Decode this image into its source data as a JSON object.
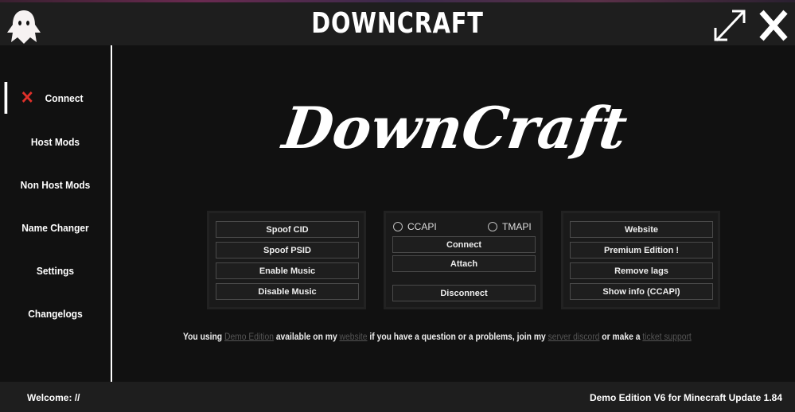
{
  "window": {
    "title": "DOWNCRAFT"
  },
  "logo": {
    "text": "DownCraft"
  },
  "sidebar": {
    "items": [
      {
        "label": "Connect",
        "active": true
      },
      {
        "label": "Host Mods"
      },
      {
        "label": "Non Host Mods"
      },
      {
        "label": "Name Changer"
      },
      {
        "label": "Settings"
      },
      {
        "label": "Changelogs"
      }
    ]
  },
  "group1": {
    "buttons": [
      "Spoof CID",
      "Spoof PSID",
      "Enable Music",
      "Disable Music"
    ]
  },
  "group2": {
    "radio1": "CCAPI",
    "radio2": "TMAPI",
    "connect": "Connect",
    "attach": "Attach",
    "disconnect": "Disconnect"
  },
  "group3": {
    "buttons": [
      "Website",
      "Premium Edition !",
      "Remove lags",
      "Show info (CCAPI)"
    ]
  },
  "info": {
    "t1": "You using ",
    "l1": "Demo Edition",
    "t2": " available on my ",
    "l2": "website",
    "t3": " if you have a question or a problems, join my ",
    "l3": "server discord",
    "t4": " or make a ",
    "l4": "ticket support"
  },
  "footer": {
    "welcome": "Welcome:",
    "user": "//",
    "version": "Demo Edition V6 for Minecraft Update 1.84"
  }
}
